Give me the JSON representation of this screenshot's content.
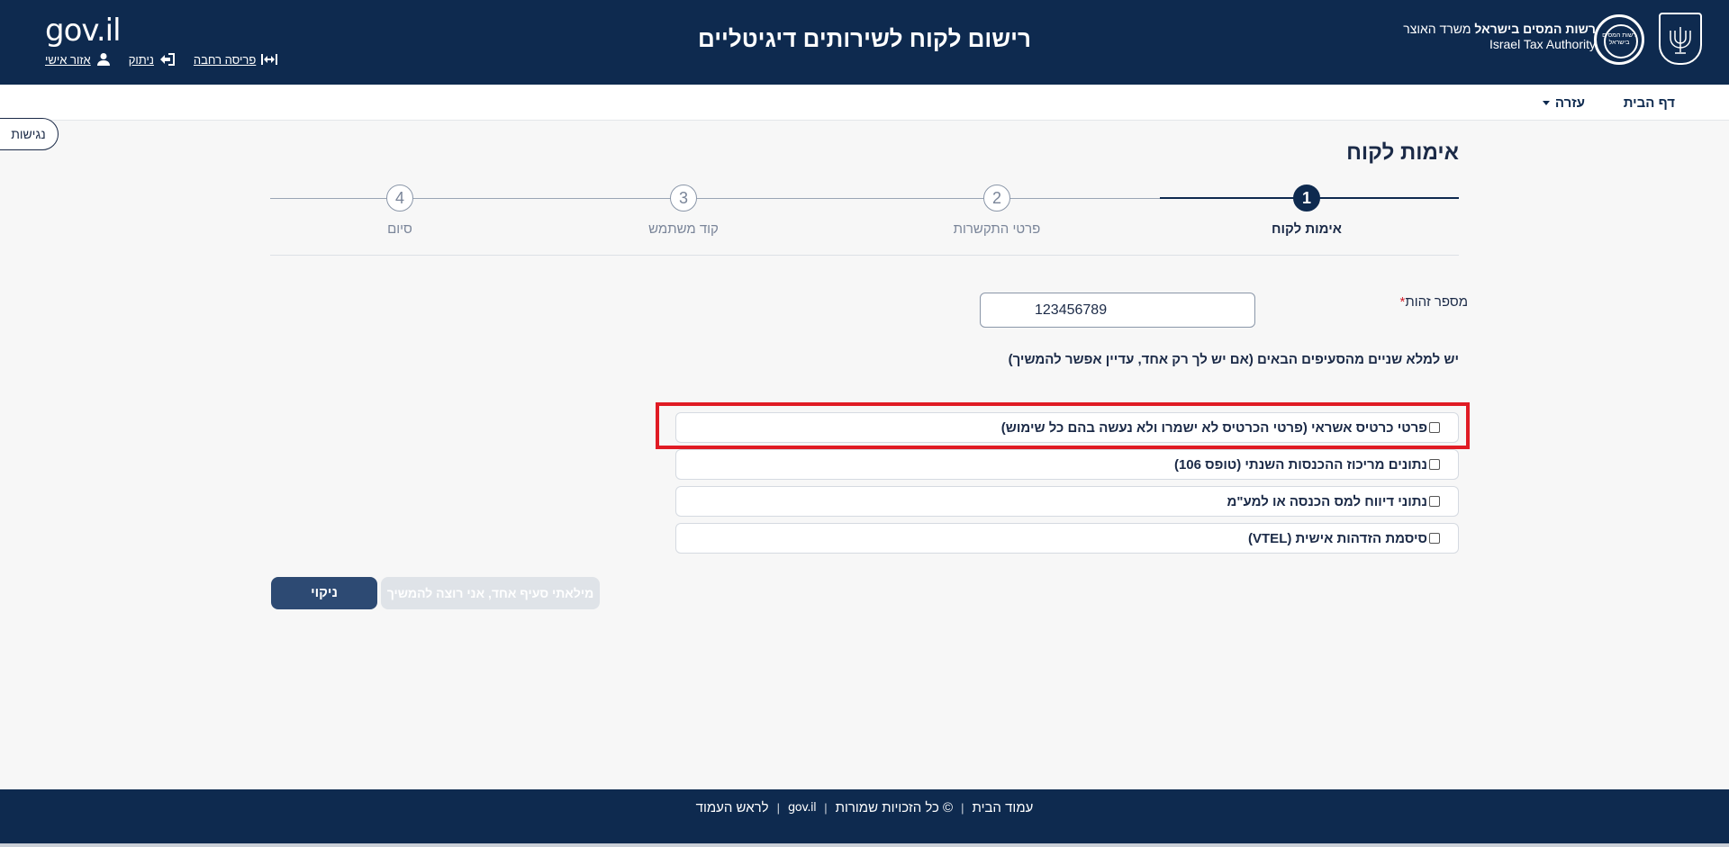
{
  "header": {
    "logo": "gov.il",
    "title": "רישום לקוח לשירותים דיגיטליים",
    "authority_he_bold": "רשות המסים בישראל",
    "authority_he_rest": " משרד האוצר",
    "authority_en": "Israel Tax Authority",
    "emblem_text": "רשות המסים בישראל",
    "links": {
      "personal_area": "אזור אישי",
      "logout": "ניתוק",
      "wide_layout": "פריסה רחבה"
    }
  },
  "nav": {
    "home": "דף הבית",
    "help": "עזרה"
  },
  "accessibility": "נגישות",
  "page_title": "אימות לקוח",
  "stepper": {
    "steps": [
      {
        "number": "1",
        "label": "אימות לקוח",
        "active": true
      },
      {
        "number": "2",
        "label": "פרטי התקשרות",
        "active": false
      },
      {
        "number": "3",
        "label": "קוד משתמש",
        "active": false
      },
      {
        "number": "4",
        "label": "סיום",
        "active": false
      }
    ]
  },
  "form": {
    "id_label": "מספר זהות",
    "required_mark": "*",
    "id_value": "123456789",
    "instruction": "יש למלא שניים מהסעיפים הבאים (אם יש לך רק אחד, עדיין אפשר להמשיך)",
    "options": [
      "פרטי כרטיס אשראי (פרטי הכרטיס לא ישמרו ולא נעשה בהם כל שימוש)",
      "נתונים מריכוז ההכנסות השנתי (טופס 106)",
      "נתוני דיווח למס הכנסה או למע\"מ",
      "סיסמת הזדהות אישית (VTEL)"
    ],
    "continue_button": "מילאתי סעיף אחד, אני רוצה להמשיך",
    "clear_button": "ניקוי"
  },
  "footer": {
    "home": "עמוד הבית",
    "copyright": "© כל הזכויות שמורות",
    "gov_logo": "gov.il",
    "top": "לראש העמוד"
  },
  "colors": {
    "brand_dark": "#0e2a4f",
    "highlight": "#e01b24",
    "button_primary": "#2d4a73",
    "button_disabled": "#dfe3e8"
  }
}
